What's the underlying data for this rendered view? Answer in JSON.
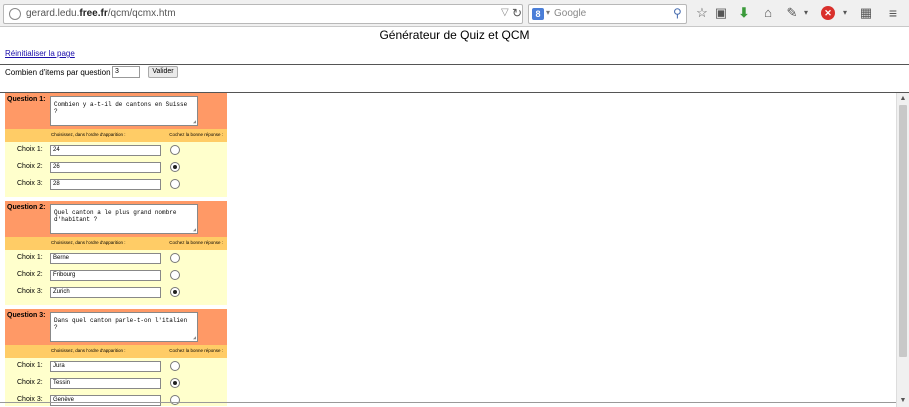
{
  "browser": {
    "url_prefix": "gerard.ledu.",
    "url_domain": "free.fr",
    "url_path": "/qcm/qcmx.htm",
    "search_engine_letter": "8",
    "search_placeholder": "Google"
  },
  "page": {
    "title": "Générateur de Quiz et QCM",
    "reset_link": "Réinitialiser la page",
    "items_label": "Combien d'items par question ?",
    "items_value": "3",
    "validate_label": "Valider"
  },
  "questions": [
    {
      "label": "Question 1:",
      "text": "Combien y a-t-il de cantons en Suisse ?",
      "sub_left": "Choisissez, dans l'ordre d'apparition :",
      "sub_right": "Cochez la bonne réponse :",
      "choices": [
        {
          "label": "Choix 1:",
          "value": "24",
          "checked": false
        },
        {
          "label": "Choix 2:",
          "value": "26",
          "checked": true
        },
        {
          "label": "Choix 3:",
          "value": "28",
          "checked": false
        }
      ]
    },
    {
      "label": "Question 2:",
      "text": "Quel canton a le plus grand nombre d'habitant ?",
      "sub_left": "Choisissez, dans l'ordre d'apparition :",
      "sub_right": "Cochez la bonne réponse :",
      "choices": [
        {
          "label": "Choix 1:",
          "value": "Berne",
          "checked": false
        },
        {
          "label": "Choix 2:",
          "value": "Fribourg",
          "checked": false
        },
        {
          "label": "Choix 3:",
          "value": "Zurich",
          "checked": true
        }
      ]
    },
    {
      "label": "Question 3:",
      "text": "Dans quel canton parle-t-on l'italien ?",
      "sub_left": "Choisissez, dans l'ordre d'apparition :",
      "sub_right": "Cochez la bonne réponse :",
      "choices": [
        {
          "label": "Choix 1:",
          "value": "Jura",
          "checked": false
        },
        {
          "label": "Choix 2:",
          "value": "Tessin",
          "checked": true
        },
        {
          "label": "Choix 3:",
          "value": "Genève",
          "checked": false
        }
      ]
    }
  ]
}
